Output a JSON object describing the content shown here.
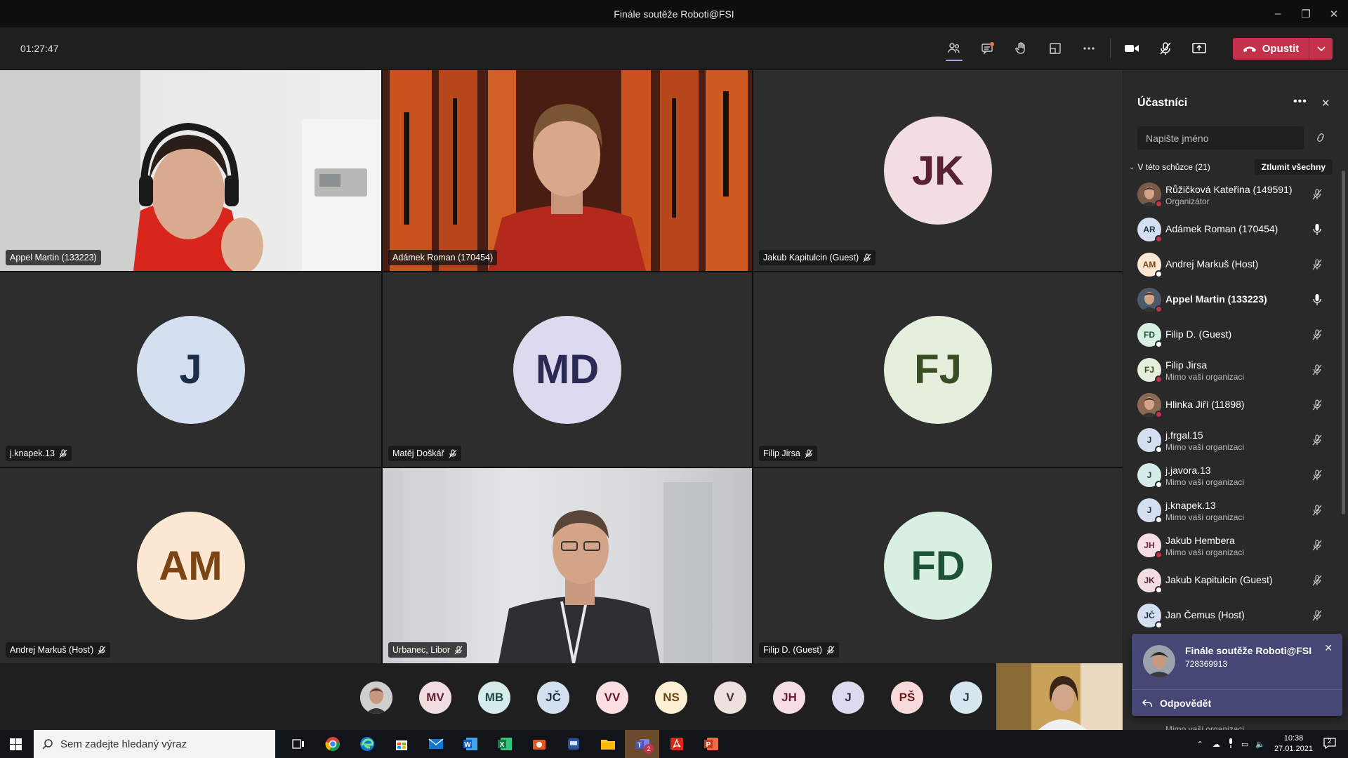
{
  "window": {
    "title": "Finále soutěže Roboti@FSI",
    "controls": [
      "minimize-icon",
      "restore-icon",
      "close-icon"
    ]
  },
  "toolbar": {
    "timer": "01:27:47",
    "icons": [
      "people-icon",
      "chat-icon",
      "raise-hand-icon",
      "layout-icon",
      "more-icon"
    ],
    "leave_label": "Opustit"
  },
  "tiles": [
    {
      "name": "Appel Martin (133223)",
      "type": "video",
      "muted": false
    },
    {
      "name": "Adámek Roman (170454)",
      "type": "video",
      "muted": false
    },
    {
      "name": "Jakub Kapitulcin (Guest)",
      "type": "avatar",
      "initials": "JK",
      "bg": "#f2dde0",
      "fg": "#5a2130",
      "muted": true
    },
    {
      "name": "j.knapek.13",
      "type": "avatar",
      "initials": "J",
      "bg": "#d4e0f0",
      "fg": "#1d2e4d",
      "muted": true
    },
    {
      "name": "Matěj Doškář",
      "type": "avatar",
      "initials": "MD",
      "bg": "#dcdaee",
      "fg": "#2b2a55",
      "muted": true
    },
    {
      "name": "Filip Jirsa",
      "type": "avatar",
      "initials": "FJ",
      "bg": "#e5efdb",
      "fg": "#3a4d24",
      "muted": true
    },
    {
      "name": "Andrej Markuš (Hosť)",
      "type": "avatar",
      "initials": "AM",
      "bg": "#fde8d3",
      "fg": "#7a4414",
      "muted": true
    },
    {
      "name": "Urbanec, Libor",
      "type": "video",
      "muted": true
    },
    {
      "name": "Filip D. (Guest)",
      "type": "avatar",
      "initials": "FD",
      "bg": "#d7f0e2",
      "fg": "#1d5236",
      "muted": true
    }
  ],
  "strip": [
    {
      "initials": "",
      "photo": true
    },
    {
      "initials": "MV",
      "bg": "#f2dde0",
      "fg": "#5a2130"
    },
    {
      "initials": "MB",
      "bg": "#d6ecea",
      "fg": "#1f4745"
    },
    {
      "initials": "JČ",
      "bg": "#d4e0f0",
      "fg": "#1d2e4d"
    },
    {
      "initials": "VV",
      "bg": "#fbdfe3",
      "fg": "#6b1e2a"
    },
    {
      "initials": "NS",
      "bg": "#fdf0d4",
      "fg": "#6b4a14"
    },
    {
      "initials": "V",
      "bg": "#efe0e0",
      "fg": "#4d2a2a"
    },
    {
      "initials": "JH",
      "bg": "#f7dde4",
      "fg": "#6b1e38"
    },
    {
      "initials": "J",
      "bg": "#dcdaee",
      "fg": "#2b2a55"
    },
    {
      "initials": "PŠ",
      "bg": "#f8dada",
      "fg": "#6b1d1d"
    },
    {
      "initials": "J",
      "bg": "#d6e6ef",
      "fg": "#1d3f52"
    }
  ],
  "panel": {
    "title": "Účastníci",
    "search_placeholder": "Napište jméno",
    "section_label": "V této schůzce (21)",
    "mute_all_label": "Ztlumit všechny",
    "participants": [
      {
        "name": "Růžičková Kateřina (149591)",
        "sub": "Organizátor",
        "initials": "",
        "photo": true,
        "bg": "#7a5a48",
        "status": "#c4314b",
        "mic": "muted",
        "bold": false
      },
      {
        "name": "Adámek Roman (170454)",
        "sub": "",
        "initials": "AR",
        "bg": "#d4e0f0",
        "fg": "#1d2e4d",
        "status": "#c4314b",
        "mic": "on",
        "bold": false
      },
      {
        "name": "Andrej Markuš (Host)",
        "sub": "",
        "initials": "AM",
        "bg": "#fde8d3",
        "fg": "#7a4414",
        "status": "#ffffff",
        "mic": "muted",
        "bold": false
      },
      {
        "name": "Appel Martin (133223)",
        "sub": "",
        "initials": "",
        "photo": true,
        "bg": "#4a5a6a",
        "status": "#c4314b",
        "mic": "on",
        "bold": true
      },
      {
        "name": "Filip D. (Guest)",
        "sub": "",
        "initials": "FD",
        "bg": "#d7f0e2",
        "fg": "#1d5236",
        "status": "#ffffff",
        "mic": "muted",
        "bold": false
      },
      {
        "name": "Filip Jirsa",
        "sub": "Mimo vaši organizaci",
        "initials": "FJ",
        "bg": "#e5efdb",
        "fg": "#3a4d24",
        "status": "#c4314b",
        "mic": "muted",
        "bold": false
      },
      {
        "name": "Hlinka Jiří (11898)",
        "sub": "",
        "initials": "",
        "photo": true,
        "bg": "#8a6a55",
        "status": "#c4314b",
        "mic": "muted",
        "bold": false
      },
      {
        "name": "j.frgal.15",
        "sub": "Mimo vaši organizaci",
        "initials": "J",
        "bg": "#d4e0f0",
        "fg": "#1d2e4d",
        "status": "#ffffff",
        "mic": "muted",
        "bold": false
      },
      {
        "name": "j.javora.13",
        "sub": "Mimo vaši organizaci",
        "initials": "J",
        "bg": "#d6ecea",
        "fg": "#1f4745",
        "status": "#ffffff",
        "mic": "muted",
        "bold": false
      },
      {
        "name": "j.knapek.13",
        "sub": "Mimo vaši organizaci",
        "initials": "J",
        "bg": "#d4e0f0",
        "fg": "#1d2e4d",
        "status": "#ffffff",
        "mic": "muted",
        "bold": false
      },
      {
        "name": "Jakub Hembera",
        "sub": "Mimo vaši organizaci",
        "initials": "JH",
        "bg": "#f7dde4",
        "fg": "#6b1e38",
        "status": "#c4314b",
        "mic": "muted",
        "bold": false
      },
      {
        "name": "Jakub Kapitulcin (Guest)",
        "sub": "",
        "initials": "JK",
        "bg": "#f2dde0",
        "fg": "#5a2130",
        "status": "#ffffff",
        "mic": "muted",
        "bold": false
      },
      {
        "name": "Jan Čemus (Host)",
        "sub": "",
        "initials": "JČ",
        "bg": "#d4e0f0",
        "fg": "#1d2e4d",
        "status": "#ffffff",
        "mic": "muted",
        "bold": false
      }
    ],
    "partial_row_sub": "Mimo vaši organizaci"
  },
  "toast": {
    "title": "Finále soutěže Roboti@FSI",
    "number": "728369913",
    "reply_label": "Odpovědět"
  },
  "taskbar": {
    "search_placeholder": "Sem zadejte hledaný výraz",
    "apps": [
      "task-view-icon",
      "chrome-icon",
      "edge-icon",
      "store-icon",
      "mail-icon",
      "word-icon",
      "excel-icon",
      "snip-icon",
      "remote-icon",
      "explorer-icon",
      "teams-icon",
      "acrobat-icon",
      "powerpoint-icon"
    ],
    "teams_badge": "2",
    "time": "10:38",
    "date": "27.01.2021",
    "notif_count": "2"
  },
  "colors": {
    "accent": "#6264a7",
    "leave": "#c4314b",
    "panel": "#292929",
    "toolbar": "#1f1f1f"
  }
}
